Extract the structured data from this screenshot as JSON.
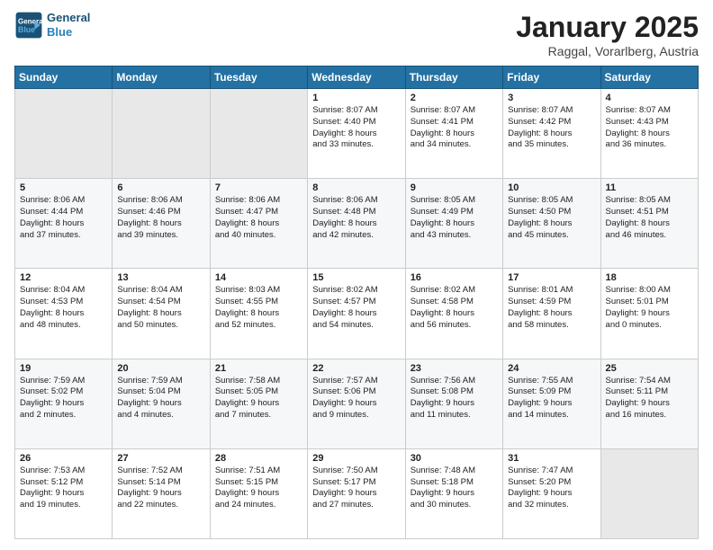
{
  "header": {
    "logo_line1": "General",
    "logo_line2": "Blue",
    "month": "January 2025",
    "location": "Raggal, Vorarlberg, Austria"
  },
  "weekdays": [
    "Sunday",
    "Monday",
    "Tuesday",
    "Wednesday",
    "Thursday",
    "Friday",
    "Saturday"
  ],
  "weeks": [
    [
      {
        "day": "",
        "info": ""
      },
      {
        "day": "",
        "info": ""
      },
      {
        "day": "",
        "info": ""
      },
      {
        "day": "1",
        "info": "Sunrise: 8:07 AM\nSunset: 4:40 PM\nDaylight: 8 hours\nand 33 minutes."
      },
      {
        "day": "2",
        "info": "Sunrise: 8:07 AM\nSunset: 4:41 PM\nDaylight: 8 hours\nand 34 minutes."
      },
      {
        "day": "3",
        "info": "Sunrise: 8:07 AM\nSunset: 4:42 PM\nDaylight: 8 hours\nand 35 minutes."
      },
      {
        "day": "4",
        "info": "Sunrise: 8:07 AM\nSunset: 4:43 PM\nDaylight: 8 hours\nand 36 minutes."
      }
    ],
    [
      {
        "day": "5",
        "info": "Sunrise: 8:06 AM\nSunset: 4:44 PM\nDaylight: 8 hours\nand 37 minutes."
      },
      {
        "day": "6",
        "info": "Sunrise: 8:06 AM\nSunset: 4:46 PM\nDaylight: 8 hours\nand 39 minutes."
      },
      {
        "day": "7",
        "info": "Sunrise: 8:06 AM\nSunset: 4:47 PM\nDaylight: 8 hours\nand 40 minutes."
      },
      {
        "day": "8",
        "info": "Sunrise: 8:06 AM\nSunset: 4:48 PM\nDaylight: 8 hours\nand 42 minutes."
      },
      {
        "day": "9",
        "info": "Sunrise: 8:05 AM\nSunset: 4:49 PM\nDaylight: 8 hours\nand 43 minutes."
      },
      {
        "day": "10",
        "info": "Sunrise: 8:05 AM\nSunset: 4:50 PM\nDaylight: 8 hours\nand 45 minutes."
      },
      {
        "day": "11",
        "info": "Sunrise: 8:05 AM\nSunset: 4:51 PM\nDaylight: 8 hours\nand 46 minutes."
      }
    ],
    [
      {
        "day": "12",
        "info": "Sunrise: 8:04 AM\nSunset: 4:53 PM\nDaylight: 8 hours\nand 48 minutes."
      },
      {
        "day": "13",
        "info": "Sunrise: 8:04 AM\nSunset: 4:54 PM\nDaylight: 8 hours\nand 50 minutes."
      },
      {
        "day": "14",
        "info": "Sunrise: 8:03 AM\nSunset: 4:55 PM\nDaylight: 8 hours\nand 52 minutes."
      },
      {
        "day": "15",
        "info": "Sunrise: 8:02 AM\nSunset: 4:57 PM\nDaylight: 8 hours\nand 54 minutes."
      },
      {
        "day": "16",
        "info": "Sunrise: 8:02 AM\nSunset: 4:58 PM\nDaylight: 8 hours\nand 56 minutes."
      },
      {
        "day": "17",
        "info": "Sunrise: 8:01 AM\nSunset: 4:59 PM\nDaylight: 8 hours\nand 58 minutes."
      },
      {
        "day": "18",
        "info": "Sunrise: 8:00 AM\nSunset: 5:01 PM\nDaylight: 9 hours\nand 0 minutes."
      }
    ],
    [
      {
        "day": "19",
        "info": "Sunrise: 7:59 AM\nSunset: 5:02 PM\nDaylight: 9 hours\nand 2 minutes."
      },
      {
        "day": "20",
        "info": "Sunrise: 7:59 AM\nSunset: 5:04 PM\nDaylight: 9 hours\nand 4 minutes."
      },
      {
        "day": "21",
        "info": "Sunrise: 7:58 AM\nSunset: 5:05 PM\nDaylight: 9 hours\nand 7 minutes."
      },
      {
        "day": "22",
        "info": "Sunrise: 7:57 AM\nSunset: 5:06 PM\nDaylight: 9 hours\nand 9 minutes."
      },
      {
        "day": "23",
        "info": "Sunrise: 7:56 AM\nSunset: 5:08 PM\nDaylight: 9 hours\nand 11 minutes."
      },
      {
        "day": "24",
        "info": "Sunrise: 7:55 AM\nSunset: 5:09 PM\nDaylight: 9 hours\nand 14 minutes."
      },
      {
        "day": "25",
        "info": "Sunrise: 7:54 AM\nSunset: 5:11 PM\nDaylight: 9 hours\nand 16 minutes."
      }
    ],
    [
      {
        "day": "26",
        "info": "Sunrise: 7:53 AM\nSunset: 5:12 PM\nDaylight: 9 hours\nand 19 minutes."
      },
      {
        "day": "27",
        "info": "Sunrise: 7:52 AM\nSunset: 5:14 PM\nDaylight: 9 hours\nand 22 minutes."
      },
      {
        "day": "28",
        "info": "Sunrise: 7:51 AM\nSunset: 5:15 PM\nDaylight: 9 hours\nand 24 minutes."
      },
      {
        "day": "29",
        "info": "Sunrise: 7:50 AM\nSunset: 5:17 PM\nDaylight: 9 hours\nand 27 minutes."
      },
      {
        "day": "30",
        "info": "Sunrise: 7:48 AM\nSunset: 5:18 PM\nDaylight: 9 hours\nand 30 minutes."
      },
      {
        "day": "31",
        "info": "Sunrise: 7:47 AM\nSunset: 5:20 PM\nDaylight: 9 hours\nand 32 minutes."
      },
      {
        "day": "",
        "info": ""
      }
    ]
  ]
}
